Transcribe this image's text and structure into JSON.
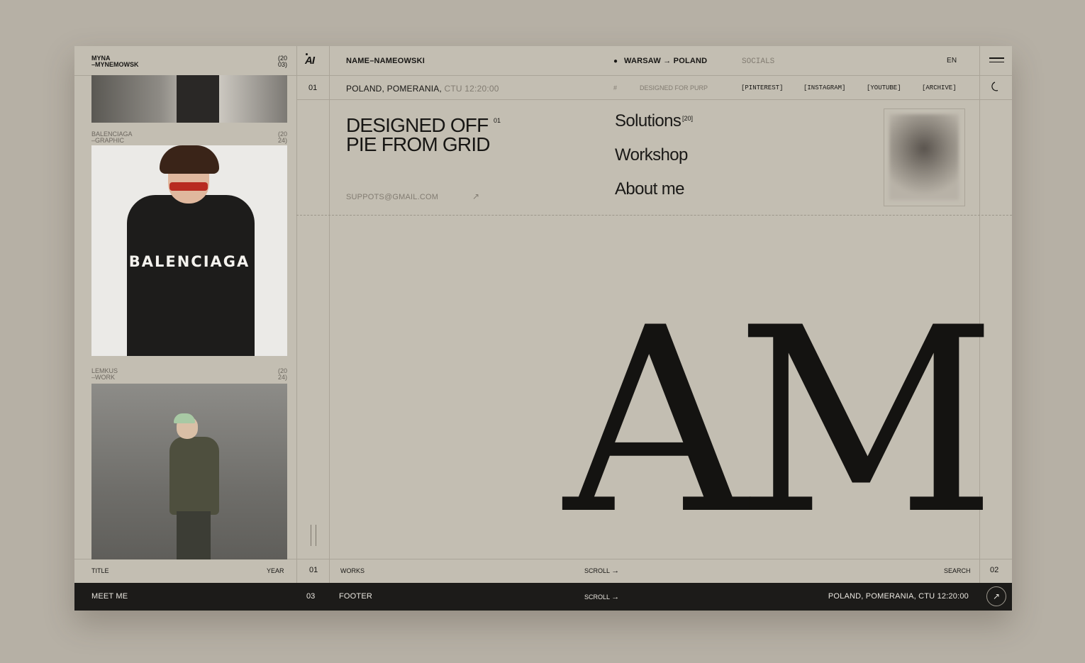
{
  "left": {
    "brand_line1": "MYNA",
    "brand_line2": "–MYNEMOWSK",
    "brand_year1": "(20",
    "brand_year2": "03)",
    "cards": [
      {
        "title1": "BALENCIAGA",
        "title2": "–GRAPHIC",
        "year1": "(20",
        "year2": "24)",
        "overlay": "BALENCIAGA"
      },
      {
        "title1": "LEMKUS",
        "title2": "–WORK",
        "year1": "(20",
        "year2": "24)"
      }
    ],
    "footer_title": "TITLE",
    "footer_year": "YEAR",
    "meet": "MEET ME"
  },
  "header": {
    "logo": "AI",
    "name": "NAME–NAMEOWSKI",
    "location_from": "WARSAW",
    "location_to": "POLAND",
    "socials": "SOCIALS",
    "lang": "EN",
    "row_num": "01",
    "place": "POLAND, POMERANIA,",
    "time": "CTU 12:20:00",
    "hash": "#",
    "designed_for": "DESIGNED FOR PURP",
    "social_links": [
      "[PINTEREST]",
      "[INSTAGRAM]",
      "[YOUTUBE]",
      "[ARCHIVE]"
    ]
  },
  "hero": {
    "line1": "DESIGNED OFF",
    "line2": "PIE FROM GRID",
    "sup": "01",
    "email": "SUPPOTS@GMAIL.COM",
    "monogram": "AM"
  },
  "nav": {
    "solutions": "Solutions",
    "solutions_count": "[20]",
    "workshop": "Workshop",
    "about": "About me"
  },
  "bottom": {
    "num_left": "01",
    "works": "WORKS",
    "scroll": "SCROLL",
    "search": "SEARCH",
    "num_right": "02",
    "footer_num": "03",
    "footer": "FOOTER",
    "footer_scroll": "SCROLL",
    "footer_place": "POLAND, POMERANIA, CTU 12:20:00"
  }
}
